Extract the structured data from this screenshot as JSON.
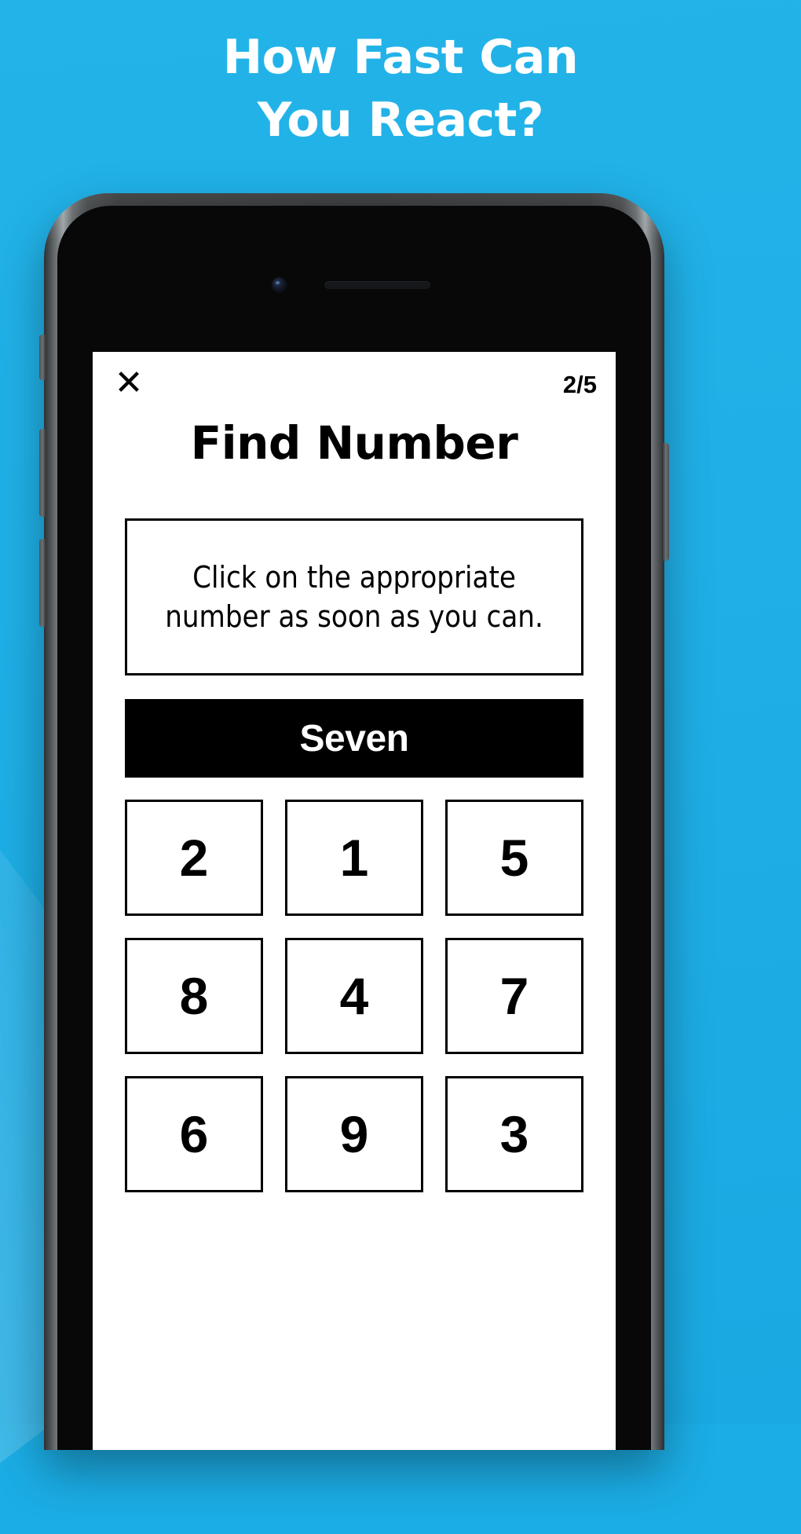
{
  "background": {
    "color_primary": "#1fb0e7",
    "color_accent": "#5bc8ee"
  },
  "headline": {
    "line1": "How Fast Can",
    "line2": "You React?",
    "color": "#ffffff"
  },
  "phone": {
    "frame_color": "#1c1e20",
    "bezel_color": "#080809",
    "screen_background": "#ffffff",
    "hardware": {
      "camera": "camera-lens",
      "speaker": "earpiece-speaker",
      "buttons": [
        "silent-switch",
        "volume-up",
        "volume-down",
        "power"
      ]
    }
  },
  "app": {
    "close_label": "✕",
    "page_counter": "2/5",
    "title": "Find Number",
    "instruction": "Click on the appropriate number as soon as you can.",
    "prompt_word": "Seven",
    "prompt_bar_background": "#000000",
    "prompt_text_color": "#ffffff",
    "tiles": [
      {
        "value": "2"
      },
      {
        "value": "1"
      },
      {
        "value": "5"
      },
      {
        "value": "8"
      },
      {
        "value": "4"
      },
      {
        "value": "7"
      },
      {
        "value": "6"
      },
      {
        "value": "9"
      },
      {
        "value": "3"
      }
    ]
  }
}
